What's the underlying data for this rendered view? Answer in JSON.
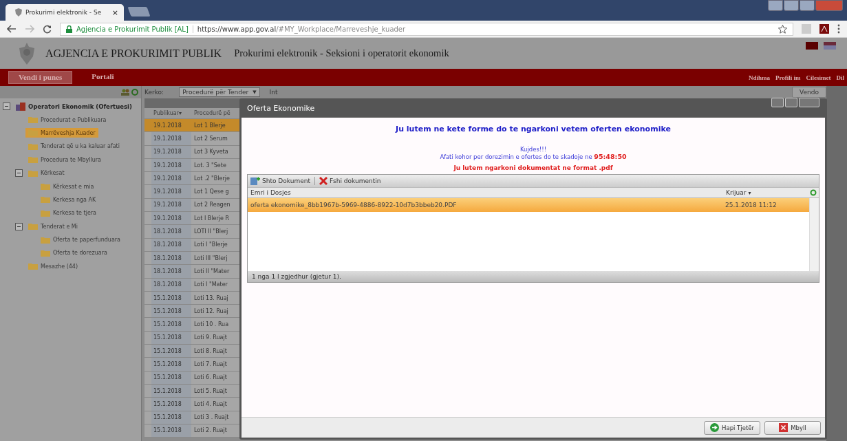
{
  "browser": {
    "tab_title": "Prokurimi elektronik - Se",
    "tab_close": "×",
    "site_name": "Agjencia e Prokurimit Publik [AL]",
    "url_host": "https://www.app.gov.al",
    "url_path": "/#MY_Workplace/Marreveshje_kuader"
  },
  "header": {
    "agency": "AGJENCIA E PROKURIMIT PUBLIK",
    "subtitle": "Prokurimi elektronik - Seksioni i operatorit ekonomik"
  },
  "nav": {
    "tabs": [
      {
        "label": "Vendi i punes",
        "selected": true
      },
      {
        "label": "Portali",
        "selected": false
      }
    ],
    "links": [
      "Ndihma",
      "Profili im",
      "Cilesimet",
      "Dil"
    ]
  },
  "toolbar": {
    "search_label": "Kerko:",
    "filter": "Procedurë për Tender",
    "filter_caret": "▼",
    "filter_extra": "Int",
    "button": "Vendo"
  },
  "sidebar": {
    "items": [
      {
        "label": "Operatori Ekonomik (Ofertuesi)",
        "kind": "root",
        "expanded": true,
        "selected": false,
        "children": [
          {
            "label": "Procedurat e Publikuara",
            "kind": "folder",
            "selected": false
          },
          {
            "label": "Marrëveshja Kuader",
            "kind": "folder",
            "selected": true
          },
          {
            "label": "Tenderat që u ka kaluar afati",
            "kind": "folder",
            "selected": false
          },
          {
            "label": "Procedura te Mbyllura",
            "kind": "folder",
            "selected": false
          },
          {
            "label": "Kërkesat",
            "kind": "folder",
            "expanded": true,
            "selected": false,
            "children": [
              {
                "label": "Kërkesat e mia",
                "kind": "folder",
                "selected": false
              },
              {
                "label": "Kerkesa nga AK",
                "kind": "folder",
                "selected": false
              },
              {
                "label": "Kerkesa te tjera",
                "kind": "folder",
                "selected": false
              }
            ]
          },
          {
            "label": "Tenderat e Mi",
            "kind": "folder",
            "expanded": true,
            "selected": false,
            "children": [
              {
                "label": "Oferta te paperfunduara",
                "kind": "folder",
                "selected": false
              },
              {
                "label": "Oferta te dorezuara",
                "kind": "folder",
                "selected": false
              }
            ]
          },
          {
            "label": "Mesazhe (44)",
            "kind": "folder",
            "selected": false
          }
        ]
      }
    ]
  },
  "grid": {
    "columns": [
      "Publikuar",
      "Procedurë pë"
    ],
    "sort_caret": "▾",
    "rows": [
      {
        "date": "19.1.2018",
        "procedure": "Lot 1 Blerje",
        "selected": true
      },
      {
        "date": "19.1.2018",
        "procedure": "Lot 2 Serum",
        "selected": false
      },
      {
        "date": "19.1.2018",
        "procedure": "Lot 3 Kyveta",
        "selected": false
      },
      {
        "date": "19.1.2018",
        "procedure": "Lot. 3 \"Sete",
        "selected": false
      },
      {
        "date": "19.1.2018",
        "procedure": "Lot .2 \"Blerje",
        "selected": false
      },
      {
        "date": "19.1.2018",
        "procedure": "Lot 1 Qese g",
        "selected": false
      },
      {
        "date": "19.1.2018",
        "procedure": "Lot 2 Reagen",
        "selected": false
      },
      {
        "date": "19.1.2018",
        "procedure": "Lot I Blerje R",
        "selected": false
      },
      {
        "date": "18.1.2018",
        "procedure": "LOTI II \"Blerj",
        "selected": false
      },
      {
        "date": "18.1.2018",
        "procedure": "Loti I \"Blerje",
        "selected": false
      },
      {
        "date": "18.1.2018",
        "procedure": "Loti III \"Blerj",
        "selected": false
      },
      {
        "date": "18.1.2018",
        "procedure": "Loti II \"Mater",
        "selected": false
      },
      {
        "date": "18.1.2018",
        "procedure": "Loti I \"Mater",
        "selected": false
      },
      {
        "date": "15.1.2018",
        "procedure": "Loti 13. Ruaj",
        "selected": false
      },
      {
        "date": "15.1.2018",
        "procedure": "Loti 12. Ruaj",
        "selected": false
      },
      {
        "date": "15.1.2018",
        "procedure": "Loti 10 . Rua",
        "selected": false
      },
      {
        "date": "15.1.2018",
        "procedure": "Loti 9. Ruajt",
        "selected": false
      },
      {
        "date": "15.1.2018",
        "procedure": "Loti 8. Ruajt",
        "selected": false
      },
      {
        "date": "15.1.2018",
        "procedure": "Loti 7. Ruajt",
        "selected": false
      },
      {
        "date": "15.1.2018",
        "procedure": "Loti 6. Ruajt",
        "selected": false
      },
      {
        "date": "15.1.2018",
        "procedure": "Loti 5. Ruajt",
        "selected": false
      },
      {
        "date": "15.1.2018",
        "procedure": "Loti 4. Ruajt",
        "selected": false
      },
      {
        "date": "15.1.2018",
        "procedure": "Loti 3 . Ruajt",
        "selected": false
      },
      {
        "date": "15.1.2018",
        "procedure": "Loti 2. Ruajt",
        "selected": false
      }
    ]
  },
  "dialog": {
    "title": "Oferta Ekonomike",
    "heading": "Ju lutem ne kete forme do te ngarkoni vetem oferten ekonomike",
    "warning": "Kujdes!!!",
    "deadline_text": "Afati kohor per dorezimin e ofertes do te skadoje ne",
    "deadline_time": "95:48:50",
    "pdf_notice": "Ju lutem ngarkoni dokumentat ne format .pdf",
    "actions": [
      {
        "label": "Shto Dokument",
        "kind": "add"
      },
      {
        "label": "Fshi dokumentin",
        "kind": "delete"
      }
    ],
    "columns": [
      "Emri i Dosjes",
      "Krijuar"
    ],
    "sort_caret": "▾",
    "files": [
      {
        "name": "oferta ekonomike_8bb1967b-5969-4886-8922-10d7b3bbeb20.PDF",
        "created": "25.1.2018 11:12",
        "selected": true
      }
    ],
    "status": "1 nga 1 I zgjedhur (gjetur 1).",
    "buttons": [
      {
        "label": "Hapi Tjetër",
        "kind": "next"
      },
      {
        "label": "Mbyll",
        "kind": "close"
      }
    ]
  }
}
